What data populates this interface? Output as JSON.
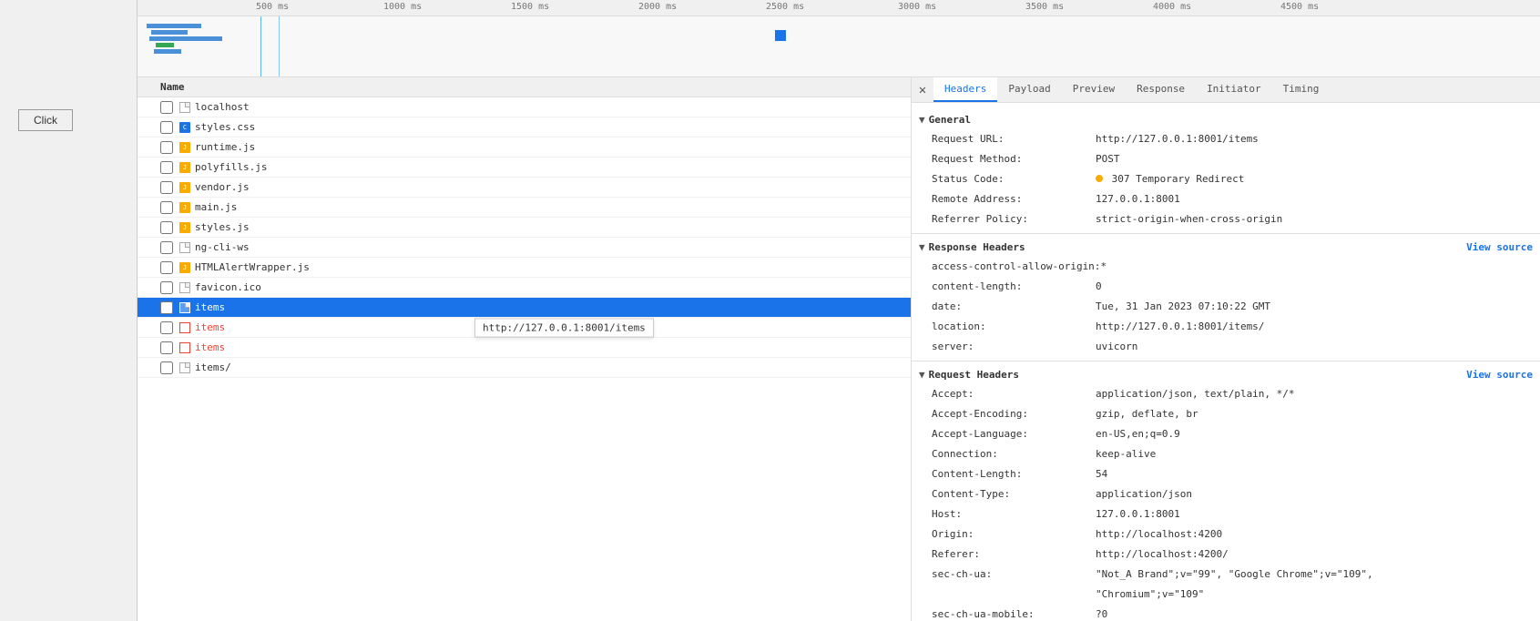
{
  "left": {
    "click_button": "Click"
  },
  "timeline": {
    "ruler_ticks": [
      {
        "label": "500 ms",
        "left_pct": 10
      },
      {
        "label": "1000 ms",
        "left_pct": 22
      },
      {
        "label": "1500 ms",
        "left_pct": 34
      },
      {
        "label": "2000 ms",
        "left_pct": 46
      },
      {
        "label": "2500 ms",
        "left_pct": 58
      },
      {
        "label": "3000 ms",
        "left_pct": 70
      },
      {
        "label": "3500 ms",
        "left_pct": 82
      },
      {
        "label": "4000 ms",
        "left_pct": 90
      },
      {
        "label": "4500 ms",
        "left_pct": 98
      }
    ]
  },
  "network_list": {
    "header": "Name",
    "rows": [
      {
        "id": "localhost",
        "name": "localhost",
        "type": "page",
        "selected": false,
        "red": false
      },
      {
        "id": "styles.css",
        "name": "styles.css",
        "type": "css",
        "selected": false,
        "red": false
      },
      {
        "id": "runtime.js",
        "name": "runtime.js",
        "type": "js",
        "selected": false,
        "red": false
      },
      {
        "id": "polyfills.js",
        "name": "polyfills.js",
        "type": "js",
        "selected": false,
        "red": false
      },
      {
        "id": "vendor.js",
        "name": "vendor.js",
        "type": "js",
        "selected": false,
        "red": false
      },
      {
        "id": "main.js",
        "name": "main.js",
        "type": "js",
        "selected": false,
        "red": false
      },
      {
        "id": "styles.js",
        "name": "styles.js",
        "type": "js",
        "selected": false,
        "red": false
      },
      {
        "id": "ng-cli-ws",
        "name": "ng-cli-ws",
        "type": "page",
        "selected": false,
        "red": false
      },
      {
        "id": "HTMLAlertWrapper.js",
        "name": "HTMLAlertWrapper.js",
        "type": "js",
        "selected": false,
        "red": false
      },
      {
        "id": "favicon.ico",
        "name": "favicon.ico",
        "type": "page",
        "selected": false,
        "red": false
      },
      {
        "id": "items-selected",
        "name": "items",
        "type": "page",
        "selected": true,
        "red": false
      },
      {
        "id": "items-red1",
        "name": "items",
        "type": "xhr",
        "selected": false,
        "red": true,
        "tooltip": "http://127.0.0.1:8001/items"
      },
      {
        "id": "items-red2",
        "name": "items",
        "type": "xhr",
        "selected": false,
        "red": true
      },
      {
        "id": "items-slash",
        "name": "items/",
        "type": "page",
        "selected": false,
        "red": false
      }
    ]
  },
  "details_panel": {
    "tabs": [
      {
        "id": "headers",
        "label": "Headers",
        "active": true
      },
      {
        "id": "payload",
        "label": "Payload",
        "active": false
      },
      {
        "id": "preview",
        "label": "Preview",
        "active": false
      },
      {
        "id": "response",
        "label": "Response",
        "active": false
      },
      {
        "id": "initiator",
        "label": "Initiator",
        "active": false
      },
      {
        "id": "timing",
        "label": "Timing",
        "active": false
      }
    ],
    "sections": {
      "general": {
        "label": "General",
        "rows": [
          {
            "key": "Request URL:",
            "value": "http://127.0.0.1:8001/items"
          },
          {
            "key": "Request Method:",
            "value": "POST"
          },
          {
            "key": "Status Code:",
            "value": "307 Temporary Redirect",
            "has_dot": true
          },
          {
            "key": "Remote Address:",
            "value": "127.0.0.1:8001"
          },
          {
            "key": "Referrer Policy:",
            "value": "strict-origin-when-cross-origin"
          }
        ]
      },
      "response_headers": {
        "label": "Response Headers",
        "link": "View source",
        "rows": [
          {
            "key": "access-control-allow-origin:",
            "value": "*"
          },
          {
            "key": "content-length:",
            "value": "0"
          },
          {
            "key": "date:",
            "value": "Tue, 31 Jan 2023 07:10:22 GMT"
          },
          {
            "key": "location:",
            "value": "http://127.0.0.1:8001/items/"
          },
          {
            "key": "server:",
            "value": "uvicorn"
          }
        ]
      },
      "request_headers": {
        "label": "Request Headers",
        "link": "View source",
        "rows": [
          {
            "key": "Accept:",
            "value": "application/json, text/plain, */*"
          },
          {
            "key": "Accept-Encoding:",
            "value": "gzip, deflate, br"
          },
          {
            "key": "Accept-Language:",
            "value": "en-US,en;q=0.9"
          },
          {
            "key": "Connection:",
            "value": "keep-alive"
          },
          {
            "key": "Content-Length:",
            "value": "54"
          },
          {
            "key": "Content-Type:",
            "value": "application/json"
          },
          {
            "key": "Host:",
            "value": "127.0.0.1:8001"
          },
          {
            "key": "Origin:",
            "value": "http://localhost:4200"
          },
          {
            "key": "Referer:",
            "value": "http://localhost:4200/"
          },
          {
            "key": "sec-ch-ua:",
            "value": "\"Not_A Brand\";v=\"99\", \"Google Chrome\";v=\"109\","
          },
          {
            "key": "",
            "value": "\"Chromium\";v=\"109\""
          },
          {
            "key": "sec-ch-ua-mobile:",
            "value": "?0"
          }
        ]
      }
    }
  }
}
